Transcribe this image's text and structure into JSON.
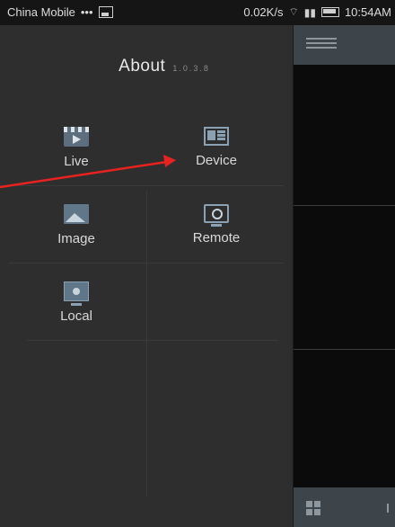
{
  "status_bar": {
    "carrier": "China Mobile",
    "dots": "•••",
    "net_speed": "0.02K/s",
    "time": "10:54AM"
  },
  "drawer": {
    "about_label": "About",
    "version": "1.0.3.8",
    "menu": [
      {
        "label": "Live",
        "icon": "live-icon"
      },
      {
        "label": "Device",
        "icon": "device-icon"
      },
      {
        "label": "Image",
        "icon": "image-icon"
      },
      {
        "label": "Remote",
        "icon": "remote-icon"
      },
      {
        "label": "Local",
        "icon": "local-icon"
      }
    ]
  },
  "main": {
    "header_icon": "menu-icon",
    "footer_icon": "grid-icon"
  },
  "annotation": {
    "color": "#e8231f",
    "points_to": "Device"
  },
  "colors": {
    "drawer_bg": "#2e2e2e",
    "status_bg": "#151515",
    "header_bg": "#3d444a",
    "video_bg": "#0b0b0b",
    "text": "#d9d9d9"
  }
}
